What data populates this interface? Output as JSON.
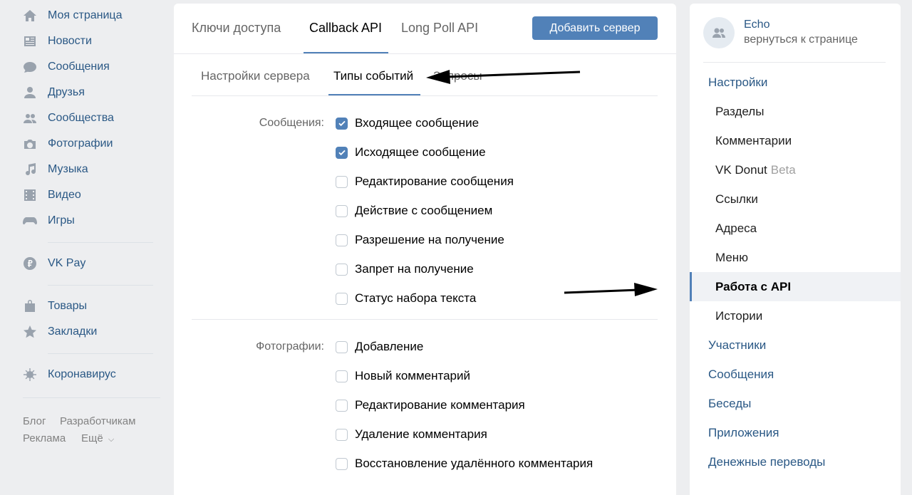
{
  "left_nav": {
    "items": [
      {
        "label": "Моя страница",
        "icon": "home-icon"
      },
      {
        "label": "Новости",
        "icon": "news-icon"
      },
      {
        "label": "Сообщения",
        "icon": "messages-icon"
      },
      {
        "label": "Друзья",
        "icon": "friends-icon"
      },
      {
        "label": "Сообщества",
        "icon": "communities-icon"
      },
      {
        "label": "Фотографии",
        "icon": "camera-icon"
      },
      {
        "label": "Музыка",
        "icon": "music-icon"
      },
      {
        "label": "Видео",
        "icon": "video-icon"
      },
      {
        "label": "Игры",
        "icon": "games-icon"
      },
      {
        "label": "VK Pay",
        "icon": "vkpay-icon"
      },
      {
        "label": "Товары",
        "icon": "shopping-bag-icon"
      },
      {
        "label": "Закладки",
        "icon": "star-icon"
      },
      {
        "label": "Коронавирус",
        "icon": "virus-icon"
      }
    ],
    "footer": {
      "blog": "Блог",
      "developers": "Разработчикам",
      "ads": "Реклама",
      "more": "Ещё"
    }
  },
  "main": {
    "tabs": [
      {
        "label": "Ключи доступа",
        "active": false
      },
      {
        "label": "Callback API",
        "active": true
      },
      {
        "label": "Long Poll API",
        "active": false
      }
    ],
    "add_server_button": "Добавить сервер",
    "subtabs": [
      {
        "label": "Настройки сервера",
        "active": false
      },
      {
        "label": "Типы событий",
        "active": true
      },
      {
        "label": "Запросы",
        "active": false
      }
    ],
    "groups": [
      {
        "label": "Сообщения:",
        "events": [
          {
            "label": "Входящее сообщение",
            "checked": true
          },
          {
            "label": "Исходящее сообщение",
            "checked": true
          },
          {
            "label": "Редактирование сообщения",
            "checked": false
          },
          {
            "label": "Действие с сообщением",
            "checked": false
          },
          {
            "label": "Разрешение на получение",
            "checked": false
          },
          {
            "label": "Запрет на получение",
            "checked": false
          },
          {
            "label": "Статус набора текста",
            "checked": false
          }
        ]
      },
      {
        "label": "Фотографии:",
        "events": [
          {
            "label": "Добавление",
            "checked": false
          },
          {
            "label": "Новый комментарий",
            "checked": false
          },
          {
            "label": "Редактирование комментария",
            "checked": false
          },
          {
            "label": "Удаление комментария",
            "checked": false
          },
          {
            "label": "Восстановление удалённого комментария",
            "checked": false
          }
        ]
      }
    ]
  },
  "right_panel": {
    "group_name": "Echo",
    "back_link": "вернуться к странице",
    "menu": [
      {
        "label": "Настройки",
        "level": "top"
      },
      {
        "label": "Разделы",
        "level": "sub"
      },
      {
        "label": "Комментарии",
        "level": "sub"
      },
      {
        "label": "VK Donut",
        "badge": "Beta",
        "level": "sub"
      },
      {
        "label": "Ссылки",
        "level": "sub"
      },
      {
        "label": "Адреса",
        "level": "sub"
      },
      {
        "label": "Меню",
        "level": "sub"
      },
      {
        "label": "Работа с API",
        "level": "sub",
        "selected": true
      },
      {
        "label": "Истории",
        "level": "sub"
      },
      {
        "label": "Участники",
        "level": "top"
      },
      {
        "label": "Сообщения",
        "level": "top"
      },
      {
        "label": "Беседы",
        "level": "top"
      },
      {
        "label": "Приложения",
        "level": "top"
      },
      {
        "label": "Денежные переводы",
        "level": "top"
      }
    ]
  },
  "colors": {
    "accent": "#5181b8",
    "link": "#2a5885",
    "background": "#edeef0"
  }
}
